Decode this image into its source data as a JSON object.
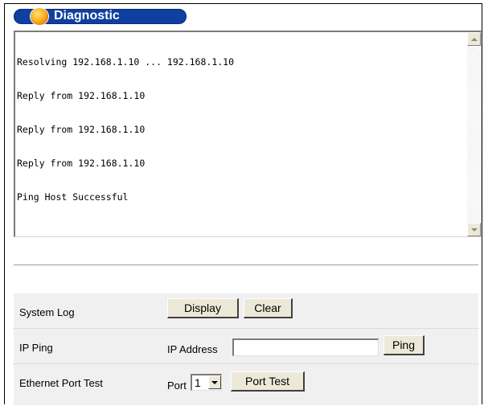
{
  "title": "Diagnostic",
  "log": {
    "lines": [
      "Resolving 192.168.1.10 ... 192.168.1.10",
      "Reply from 192.168.1.10",
      "Reply from 192.168.1.10",
      "Reply from 192.168.1.10",
      "Ping Host Successful"
    ]
  },
  "system_log": {
    "label": "System Log",
    "display_button": "Display",
    "clear_button": "Clear"
  },
  "ip_ping": {
    "label": "IP Ping",
    "ip_address_label": "IP Address",
    "ip_address_value": "",
    "ping_button": "Ping"
  },
  "ethernet_port_test": {
    "label": "Ethernet Port Test",
    "port_label": "Port",
    "port_value": "1",
    "port_test_button": "Port Test"
  },
  "icons": {
    "title_orb": "orb-icon",
    "scroll_up": "arrow-up-icon",
    "scroll_down": "arrow-down-icon",
    "dropdown": "chevron-down-icon"
  },
  "colors": {
    "title_bar": "#0f3fa0",
    "orb": "#ff9a00",
    "panel_background": "#f0f0f0"
  }
}
